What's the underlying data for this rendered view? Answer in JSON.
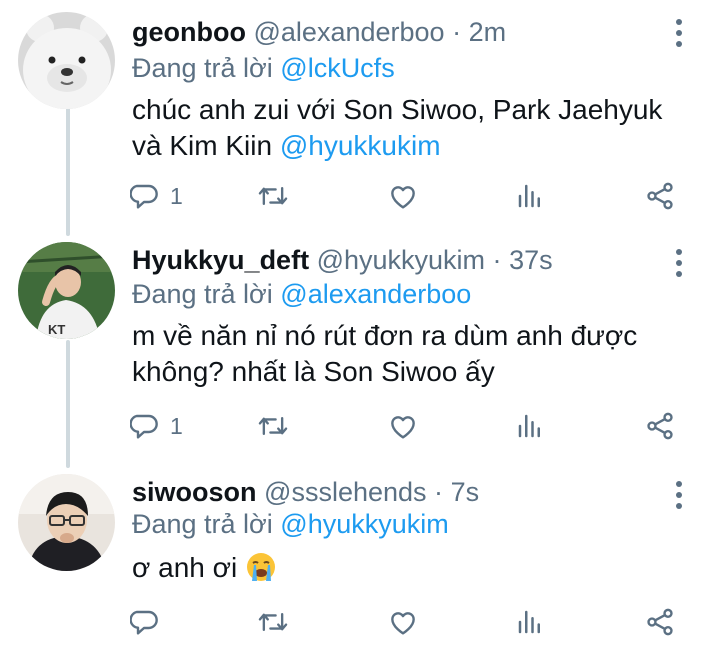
{
  "tweets": [
    {
      "name": "geonboo",
      "handle": "@alexanderboo",
      "dot": "·",
      "time": "2m",
      "reply_prefix": "Đang trả lời",
      "reply_to": "@lckUcfs",
      "text_line1": "chúc anh zui với Son Siwoo, Park Jaehyuk",
      "text_line2_prefix": "và Kim Kiin",
      "text_mention": "@hyukkukim",
      "reply_count": "1",
      "avatar": "white-bear-plush-avatar"
    },
    {
      "name": "Hyukkyu_deft",
      "handle": "@hyukkyukim",
      "dot": "·",
      "time": "37s",
      "reply_prefix": "Đang trả lời",
      "reply_to": "@alexanderboo",
      "text_line1": "m về năn nỉ nó rút đơn ra dùm anh được",
      "text_line2": "không? nhất là Son Siwoo ấy",
      "reply_count": "1",
      "avatar": "baseball-player-avatar"
    },
    {
      "name": "siwooson",
      "handle": "@ssslehends",
      "dot": "·",
      "time": "7s",
      "reply_prefix": "Đang trả lời",
      "reply_to": "@hyukkyukim",
      "text": "ơ anh ơi",
      "emoji": "loudly-crying-face",
      "avatar": "gamer-with-glasses-avatar"
    }
  ],
  "icons": [
    "reply-icon",
    "retweet-icon",
    "like-icon",
    "stats-icon",
    "share-icon",
    "more-icon"
  ],
  "colors": {
    "text": "#0f1419",
    "secondary": "#5b7083",
    "link": "#1d9bf0",
    "thread": "#cfd9de"
  }
}
